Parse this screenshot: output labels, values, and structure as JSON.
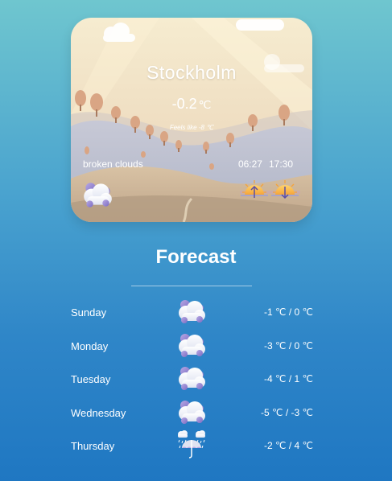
{
  "card": {
    "city": "Stockholm",
    "temperature": "-0.2",
    "unit": "℃",
    "feels_like": "Feels like -8 ℃",
    "description": "broken clouds",
    "sunrise": "06:27",
    "sunset": "17:30",
    "icon": "cloud-icon",
    "sunrise_icon": "sunrise-icon",
    "sunset_icon": "sunset-icon"
  },
  "forecast": {
    "title": "Forecast",
    "days": [
      {
        "day": "Sunday",
        "icon": "cloud-icon",
        "temps": "-1 ℃ / 0 ℃"
      },
      {
        "day": "Monday",
        "icon": "cloud-icon",
        "temps": "-3 ℃ / 0 ℃"
      },
      {
        "day": "Tuesday",
        "icon": "cloud-icon",
        "temps": "-4 ℃ / 1 ℃"
      },
      {
        "day": "Wednesday",
        "icon": "cloud-icon",
        "temps": "-5 ℃ / -3 ℃"
      },
      {
        "day": "Thursday",
        "icon": "rain-umbrella-icon",
        "temps": "-2 ℃ / 4 ℃"
      }
    ]
  },
  "colors": {
    "background_top": "#6fc6cf",
    "background_bottom": "#1f77c2",
    "card_sky": "#f3e7c7",
    "hills": "#b8bfd2"
  }
}
